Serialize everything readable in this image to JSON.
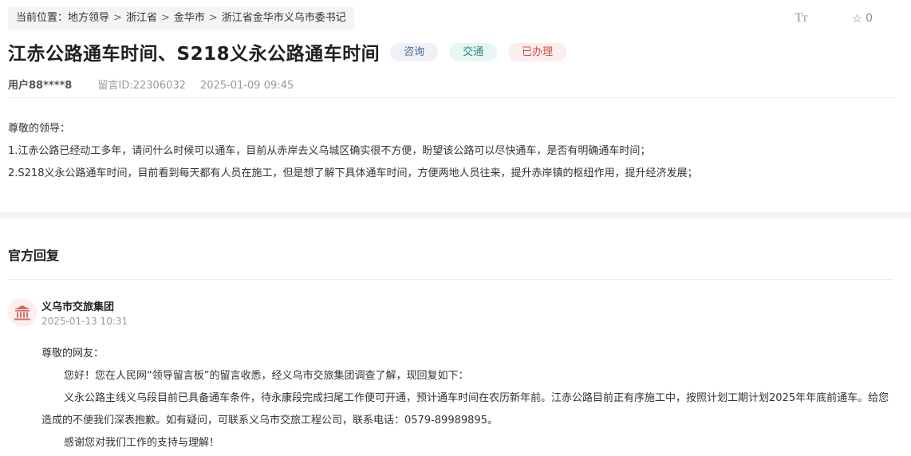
{
  "breadcrumb": {
    "prefix": "当前位置：",
    "items": [
      "地方领导",
      "浙江省",
      "金华市",
      "浙江省金华市义乌市委书记"
    ],
    "separator": ">"
  },
  "tools": {
    "font_size_icon": "font-size-icon",
    "favorite_icon": "star-outline-icon",
    "favorite_count": "0"
  },
  "post": {
    "title": "江赤公路通车时间、S218义永公路通车时间",
    "tags": [
      "咨询",
      "交通",
      "已办理"
    ],
    "user": "用户88****8",
    "message_id": "留言ID:22306032",
    "datetime": "2025-01-09 09:45",
    "content": [
      "尊敬的领导：",
      "1.江赤公路已经动工多年，请问什么时候可以通车，目前从赤岸去义乌城区确实很不方便，盼望该公路可以尽快通车，是否有明确通车时间；",
      "2.S218义永公路通车时间，目前看到每天都有人员在施工，但是想了解下具体通车时间，方便两地人员往来，提升赤岸镇的枢纽作用，提升经济发展；"
    ]
  },
  "reply": {
    "heading": "官方回复",
    "org_icon": "government-building-icon",
    "org_name": "义乌市交旅集团",
    "datetime": "2025-01-13 10:31",
    "greeting": "尊敬的网友：",
    "paragraphs": [
      "您好！您在人民网“领导留言板”的留言收悉，经义乌市交旅集团调查了解，现回复如下：",
      "义永公路主线义乌段目前已具备通车条件，待永康段完成扫尾工作便可开通，预计通车时间在农历新年前。江赤公路目前正有序施工中，按照计划工期计划2025年年底前通车。给您造成的不便我们深表抱歉。如有疑问，可联系义乌市交旅工程公司，联系电话：0579-89989895。",
      "感谢您对我们工作的支持与理解！"
    ]
  },
  "colors": {
    "tag_consult_bg": "#eef2f6",
    "tag_traffic_bg": "#e8f6f3",
    "tag_done_bg": "#fdeeee",
    "tag_done_text": "#d14a4a",
    "avatar_icon": "#d46a6a"
  }
}
